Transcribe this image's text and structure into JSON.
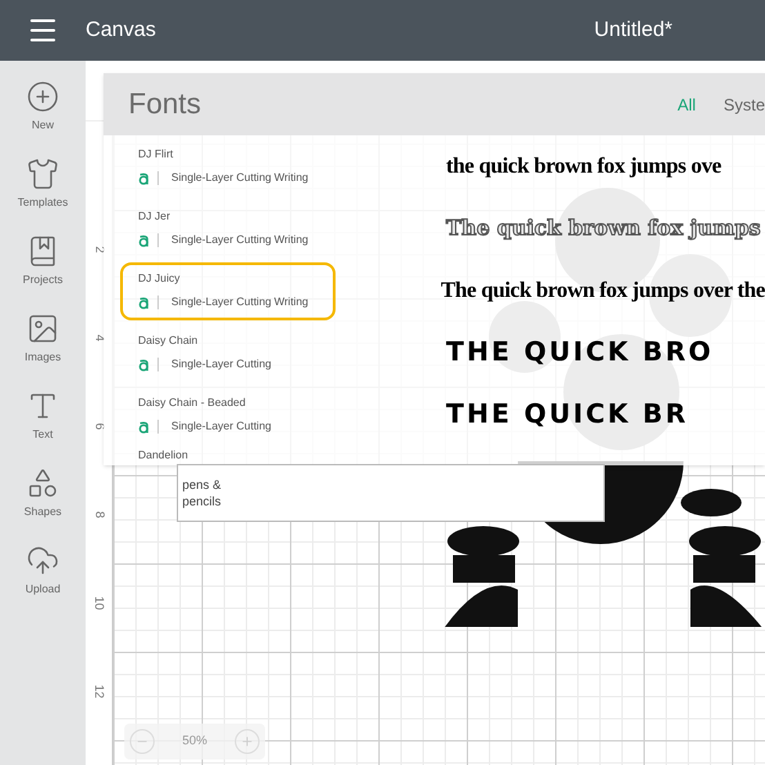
{
  "top_bar": {
    "app": "Canvas",
    "title": "Untitled*"
  },
  "sidebar": [
    {
      "label": "New"
    },
    {
      "label": "Templates"
    },
    {
      "label": "Projects"
    },
    {
      "label": "Images"
    },
    {
      "label": "Text"
    },
    {
      "label": "Shapes"
    },
    {
      "label": "Upload"
    }
  ],
  "ruler": [
    "2",
    "4",
    "6",
    "8",
    "10",
    "12"
  ],
  "fonts_panel": {
    "title": "Fonts",
    "tabs": [
      {
        "label": "All",
        "selected": true
      },
      {
        "label": "Syste",
        "selected": false
      }
    ],
    "fonts": [
      {
        "name": "DJ Flirt",
        "tags": [
          "Single-Layer Cutting",
          "Writing"
        ],
        "selected": false,
        "preview": "the quick brown fox jumps ove",
        "kind": "hand"
      },
      {
        "name": "DJ Jer",
        "tags": [
          "Single-Layer Cutting",
          "Writing"
        ],
        "selected": false,
        "preview": "The quick brown fox jumps",
        "kind": "outline"
      },
      {
        "name": "DJ Juicy",
        "tags": [
          "Single-Layer Cutting",
          "Writing"
        ],
        "selected": true,
        "preview": "The quick brown fox jumps over the",
        "kind": "hand"
      },
      {
        "name": "Daisy Chain",
        "tags": [
          "Single-Layer Cutting"
        ],
        "selected": false,
        "preview": "THE QUICK BRO",
        "kind": "heavy"
      },
      {
        "name": "Daisy Chain - Beaded",
        "tags": [
          "Single-Layer Cutting"
        ],
        "selected": false,
        "preview": "THE QUICK BR",
        "kind": "heavy"
      },
      {
        "name": "Dandelion",
        "selected": false
      }
    ]
  },
  "text_box": [
    "pens &",
    "pencils"
  ],
  "zoom": {
    "value": "50%"
  }
}
